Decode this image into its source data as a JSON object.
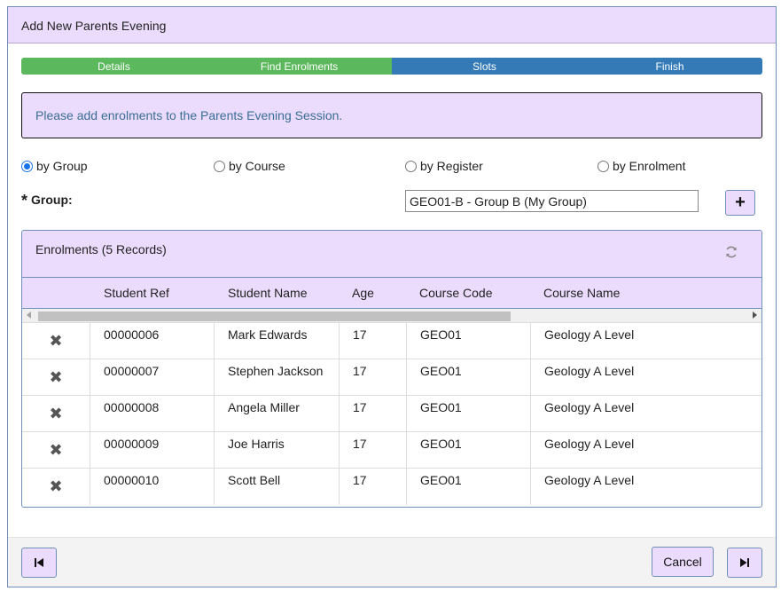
{
  "dialog": {
    "title": "Add New Parents Evening"
  },
  "steps": [
    {
      "label": "Details",
      "state": "done"
    },
    {
      "label": "Find Enrolments",
      "state": "done"
    },
    {
      "label": "Slots",
      "state": "todo"
    },
    {
      "label": "Finish",
      "state": "todo"
    }
  ],
  "info": {
    "message": "Please add enrolments to the Parents Evening Session."
  },
  "search_by": {
    "options": [
      {
        "label": "by Group",
        "checked": true
      },
      {
        "label": "by Course",
        "checked": false
      },
      {
        "label": "by Register",
        "checked": false
      },
      {
        "label": "by Enrolment",
        "checked": false
      }
    ]
  },
  "group": {
    "required_mark": "*",
    "label": "Group:",
    "value": "GEO01-B - Group B (My Group)",
    "add_icon": "plus-icon"
  },
  "enrolments": {
    "title": "Enrolments (5 Records)",
    "refresh_icon": "refresh-icon",
    "columns": [
      "Student Ref",
      "Student Name",
      "Age",
      "Course Code",
      "Course Name"
    ],
    "rows": [
      {
        "ref": "00000006",
        "name": "Mark Edwards",
        "age": "17",
        "code": "GEO01",
        "course": "Geology A Level"
      },
      {
        "ref": "00000007",
        "name": "Stephen Jackson",
        "age": "17",
        "code": "GEO01",
        "course": "Geology A Level"
      },
      {
        "ref": "00000008",
        "name": "Angela Miller",
        "age": "17",
        "code": "GEO01",
        "course": "Geology A Level"
      },
      {
        "ref": "00000009",
        "name": "Joe Harris",
        "age": "17",
        "code": "GEO01",
        "course": "Geology A Level"
      },
      {
        "ref": "00000010",
        "name": "Scott Bell",
        "age": "17",
        "code": "GEO01",
        "course": "Geology A Level"
      }
    ],
    "remove_icon": "remove-icon",
    "remove_glyph": "✖"
  },
  "footer": {
    "cancel_label": "Cancel",
    "first_icon": "skip-back-icon",
    "next_icon": "skip-forward-icon"
  },
  "colors": {
    "panel_bg": "#ebdcfd",
    "step_done": "#5cb85c",
    "step_todo": "#337ab7",
    "info_text": "#3a6e96",
    "border": "#6f8fb8"
  }
}
